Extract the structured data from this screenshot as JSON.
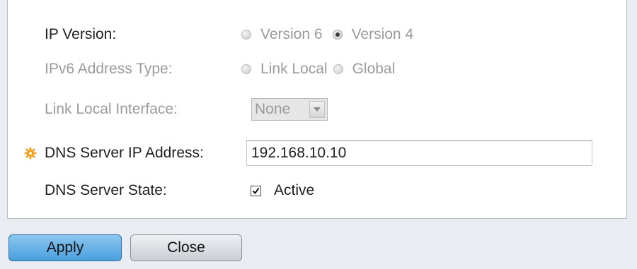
{
  "form": {
    "ip_version": {
      "label": "IP Version:",
      "options": [
        {
          "label": "Version 6",
          "checked": false
        },
        {
          "label": "Version 4",
          "checked": true
        }
      ]
    },
    "ipv6_address_type": {
      "label": "IPv6 Address Type:",
      "options": [
        {
          "label": "Link Local",
          "checked": false
        },
        {
          "label": "Global",
          "checked": false
        }
      ]
    },
    "link_local_interface": {
      "label": "Link Local Interface:",
      "selected": "None"
    },
    "dns_server_ip": {
      "label": "DNS Server IP Address:",
      "value": "192.168.10.10",
      "required_icon": "asterisk-gear-icon"
    },
    "dns_server_state": {
      "label": "DNS Server State:",
      "checkbox_label": "Active",
      "checked": true
    }
  },
  "buttons": {
    "apply": "Apply",
    "close": "Close"
  },
  "colors": {
    "apply_button": "#4a9fdc",
    "required_icon": "#f0a020",
    "disabled_text": "#9b9b9b"
  }
}
